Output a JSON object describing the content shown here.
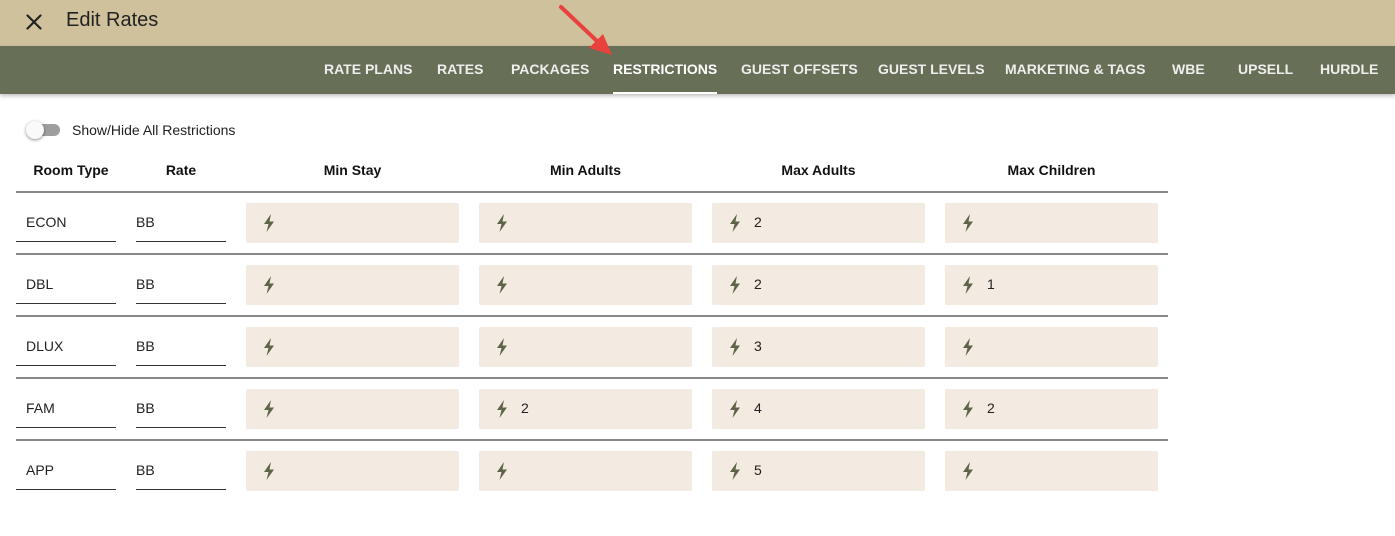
{
  "header": {
    "title": "Edit Rates",
    "close_icon": "close-icon"
  },
  "tabs": [
    {
      "label": "RATE PLANS",
      "active": false
    },
    {
      "label": "RATES",
      "active": false
    },
    {
      "label": "PACKAGES",
      "active": false
    },
    {
      "label": "RESTRICTIONS",
      "active": true
    },
    {
      "label": "GUEST OFFSETS",
      "active": false
    },
    {
      "label": "GUEST LEVELS",
      "active": false
    },
    {
      "label": "MARKETING & TAGS",
      "active": false
    },
    {
      "label": "WBE",
      "active": false
    },
    {
      "label": "UPSELL",
      "active": false
    },
    {
      "label": "HURDLE",
      "active": false
    }
  ],
  "toggle": {
    "label": "Show/Hide All Restrictions",
    "on": false
  },
  "table": {
    "columns": [
      "Room Type",
      "Rate",
      "Min Stay",
      "Min Adults",
      "Max Adults",
      "Max Children"
    ],
    "rows": [
      {
        "room_type": "ECON",
        "rate": "BB",
        "min_stay": "",
        "min_adults": "",
        "max_adults": "2",
        "max_children": ""
      },
      {
        "room_type": "DBL",
        "rate": "BB",
        "min_stay": "",
        "min_adults": "",
        "max_adults": "2",
        "max_children": "1"
      },
      {
        "room_type": "DLUX",
        "rate": "BB",
        "min_stay": "",
        "min_adults": "",
        "max_adults": "3",
        "max_children": ""
      },
      {
        "room_type": "FAM",
        "rate": "BB",
        "min_stay": "",
        "min_adults": "2",
        "max_adults": "4",
        "max_children": "2"
      },
      {
        "room_type": "APP",
        "rate": "BB",
        "min_stay": "",
        "min_adults": "",
        "max_adults": "5",
        "max_children": ""
      }
    ]
  },
  "icons": {
    "cell_icon": "lightning-bolt-icon",
    "annotation": "red-arrow-icon"
  },
  "colors": {
    "topbar": "#d0c19d",
    "navbar": "#676f56",
    "cell_bg": "#f3ebe2",
    "bolt": "#5d6448",
    "arrow": "#e8413e"
  }
}
